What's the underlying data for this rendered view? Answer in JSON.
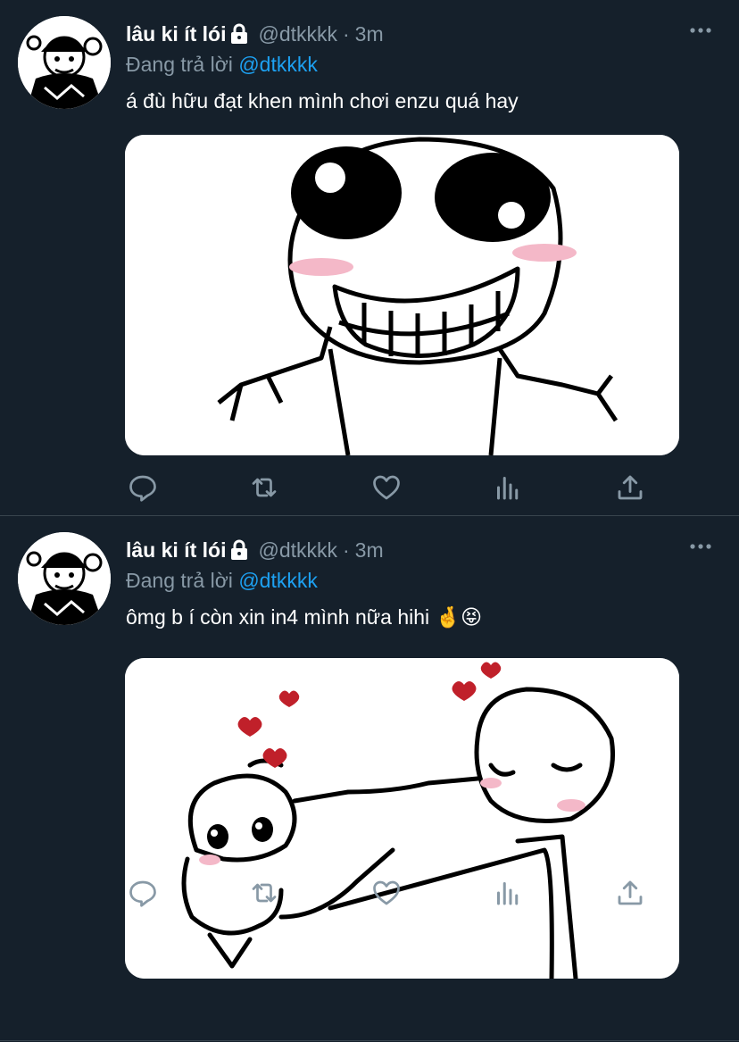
{
  "tweets": [
    {
      "display_name": "lâu ki ít lói",
      "handle": "@dtkkkk",
      "separator": "·",
      "time": "3m",
      "replying_prefix": "Đang trả lời",
      "replying_to": "@dtkkkk",
      "text": "á đù hữu đạt khen mình chơi enzu quá hay",
      "media_icon": "blushing-smile-meme-drawing"
    },
    {
      "display_name": "lâu ki ít lói",
      "handle": "@dtkkkk",
      "separator": "·",
      "time": "3m",
      "replying_prefix": "Đang trả lời",
      "replying_to": "@dtkkkk",
      "text": "ômg b í còn xin in4 mình nữa hihi 🤞😝",
      "media_icon": "pinching-cheek-hearts-drawing"
    }
  ],
  "icons": {
    "reply": "reply-icon",
    "retweet": "retweet-icon",
    "like": "like-icon",
    "analytics": "analytics-icon",
    "share": "share-icon",
    "lock": "lock-icon",
    "more": "more-icon"
  },
  "colors": {
    "background": "#15202b",
    "secondary_text": "#8899a6",
    "link": "#1da1f2",
    "divider": "#38444d"
  }
}
